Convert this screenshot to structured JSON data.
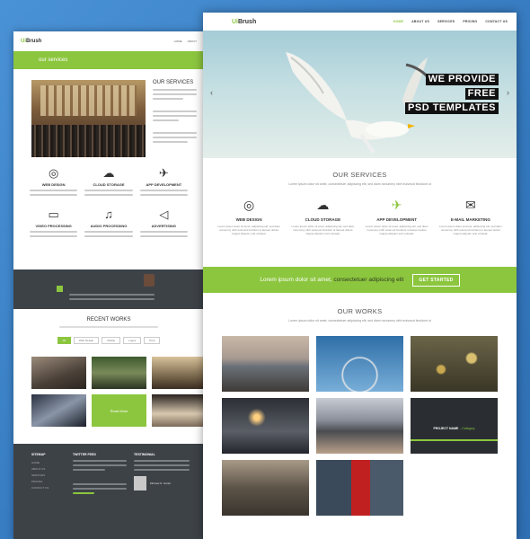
{
  "back": {
    "logo_prefix": "Ui",
    "logo_main": "Brush",
    "nav": [
      "HOME",
      "ABOUT"
    ],
    "banner": "our services",
    "services_title": "OUR SERVICES",
    "services": [
      {
        "title": "WEB DESIGN",
        "icon": "globe-icon"
      },
      {
        "title": "CLOUD STORAGE",
        "icon": "cloud-icon"
      },
      {
        "title": "APP DEVELOPMENT",
        "icon": "rocket-icon"
      },
      {
        "title": "VIDEO PROCESSING",
        "icon": "video-icon"
      },
      {
        "title": "AUDIO PROCESSING",
        "icon": "music-icon"
      },
      {
        "title": "ADVERTISING",
        "icon": "megaphone-icon"
      }
    ],
    "recent_title": "RECENT WORKS",
    "filters": [
      "All",
      "Web Design",
      "Mobile",
      "Logos",
      "Print"
    ],
    "footer": {
      "sitemap_title": "SITEMAP",
      "sitemap": [
        "HOME",
        "ABOUT US",
        "SERVICES",
        "PRICING",
        "CONTACT US"
      ],
      "tweets_title": "TWITTER FEED",
      "testimonial_title": "TESTIMONIAL",
      "testimonial_name": "Michael N. Harter"
    },
    "read_more": "Read More"
  },
  "front": {
    "logo_prefix": "Ui",
    "logo_main": "Brush",
    "nav": [
      "HOME",
      "ABOUT US",
      "SERVICES",
      "PRICING",
      "CONTACT US"
    ],
    "hero_lines": [
      "WE PROVIDE",
      "FREE",
      "PSD TEMPLATES"
    ],
    "services_title": "OUR SERVICES",
    "services_sub": "Lorem ipsum dolor sit amet, consectetuer adipiscing elit, sed diam nonummy nibh euismod tincidunt ut",
    "services": [
      {
        "title": "WEB DESIGN",
        "icon": "globe-icon"
      },
      {
        "title": "CLOUD STORAGE",
        "icon": "cloud-icon"
      },
      {
        "title": "APP DEVELOPMENT",
        "icon": "rocket-icon"
      },
      {
        "title": "E-MAIL MARKETING",
        "icon": "envelope-icon"
      }
    ],
    "service_desc": "Lorem ipsum dolor sit amet, adipiscing elit, sed diam nonummy nibh euismod tincidunt ut laoreet dolore magna aliquam erat volutpat.",
    "cta_text_a": "Lorem ipsum dolor sit amet,",
    "cta_text_b": "consectetuer adipiscing elit",
    "cta_button": "GET STARTED",
    "works_title": "OUR WORKS",
    "works_sub": "Lorem ipsum dolor sit amet, consectetuer adipiscing elit, sed diam nonummy nibh euismod tincidunt ut",
    "project_name": "PROJECT NAME",
    "project_category": "Category"
  },
  "colors": {
    "accent": "#8cc63f",
    "dark": "#3d4247",
    "background": "#3f86c9"
  }
}
